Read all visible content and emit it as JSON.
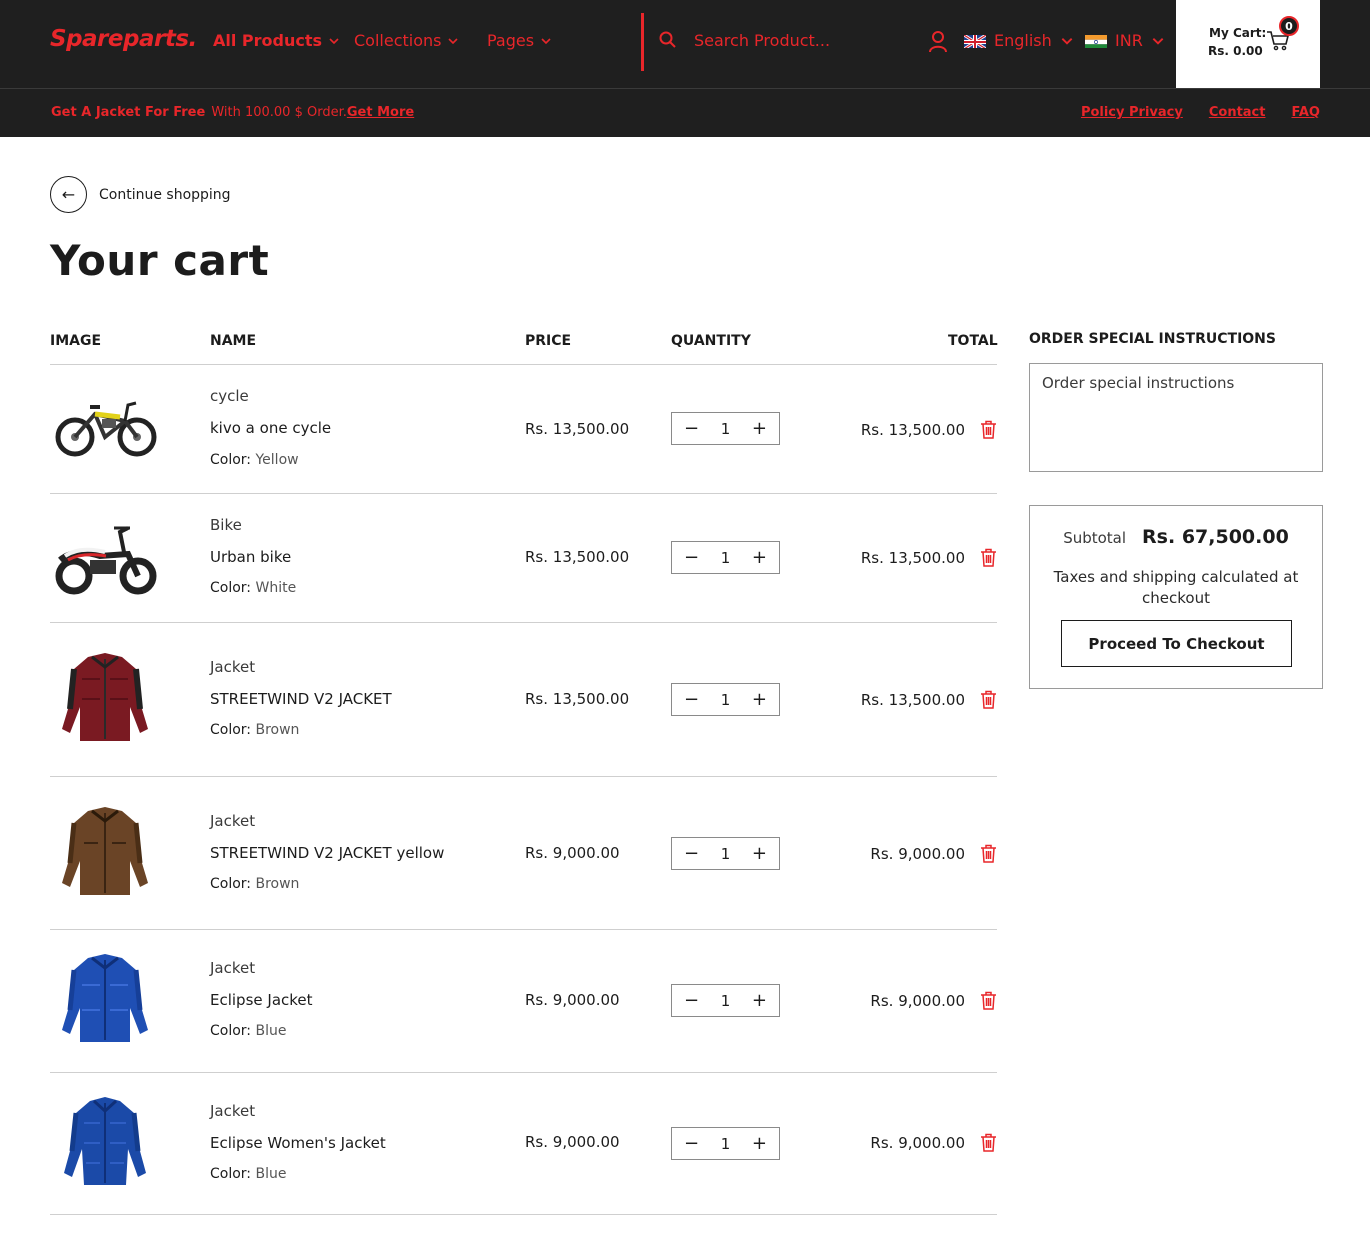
{
  "header": {
    "logo": "Spareparts.",
    "nav": [
      {
        "label": "All Products"
      },
      {
        "label": "Collections"
      },
      {
        "label": "Pages"
      }
    ],
    "search_placeholder": "Search Product...",
    "language": "English",
    "currency": "INR",
    "cart_label": "My Cart:",
    "cart_amount": "Rs. 0.00",
    "cart_count": "0"
  },
  "promo": {
    "bold": "Get A Jacket For Free",
    "text": "With 100.00 $ Order.",
    "link": "Get More"
  },
  "top_links": [
    "Policy Privacy",
    "Contact",
    "FAQ"
  ],
  "page": {
    "continue": "Continue shopping",
    "title": "Your cart"
  },
  "table_headers": {
    "image": "IMAGE",
    "name": "NAME",
    "price": "PRICE",
    "quantity": "QUANTITY",
    "total": "TOTAL"
  },
  "items": [
    {
      "vendor": "cycle",
      "name": "kivo a one cycle",
      "option_label": "Color:",
      "option_value": "Yellow",
      "price": "Rs. 13,500.00",
      "qty": "1",
      "total": "Rs. 13,500.00",
      "image_icon": "cycle-image"
    },
    {
      "vendor": "Bike",
      "name": "Urban bike",
      "option_label": "Color:",
      "option_value": "White",
      "price": "Rs. 13,500.00",
      "qty": "1",
      "total": "Rs. 13,500.00",
      "image_icon": "bike-image"
    },
    {
      "vendor": "Jacket",
      "name": "STREETWIND V2 JACKET",
      "option_label": "Color:",
      "option_value": "Brown",
      "price": "Rs. 13,500.00",
      "qty": "1",
      "total": "Rs. 13,500.00",
      "image_icon": "red-jacket-image"
    },
    {
      "vendor": "Jacket",
      "name": "STREETWIND V2 JACKET yellow",
      "option_label": "Color:",
      "option_value": "Brown",
      "price": "Rs. 9,000.00",
      "qty": "1",
      "total": "Rs. 9,000.00",
      "image_icon": "brown-jacket-image"
    },
    {
      "vendor": "Jacket",
      "name": "Eclipse Jacket",
      "option_label": "Color:",
      "option_value": "Blue",
      "price": "Rs. 9,000.00",
      "qty": "1",
      "total": "Rs. 9,000.00",
      "image_icon": "blue-jacket-image"
    },
    {
      "vendor": "Jacket",
      "name": "Eclipse Women's Jacket",
      "option_label": "Color:",
      "option_value": "Blue",
      "price": "Rs. 9,000.00",
      "qty": "1",
      "total": "Rs. 9,000.00",
      "image_icon": "blue-women-jacket-image"
    }
  ],
  "sidebar": {
    "instructions_title": "ORDER SPECIAL INSTRUCTIONS",
    "instructions_placeholder": "Order special instructions",
    "subtotal_label": "Subtotal",
    "subtotal_value": "Rs. 67,500.00",
    "tax_note": "Taxes and shipping calculated at checkout",
    "checkout_button": "Proceed To Checkout"
  },
  "colors": {
    "accent": "#e8262a",
    "header_bg": "#1f1f1f",
    "text": "#1c1c1c"
  }
}
